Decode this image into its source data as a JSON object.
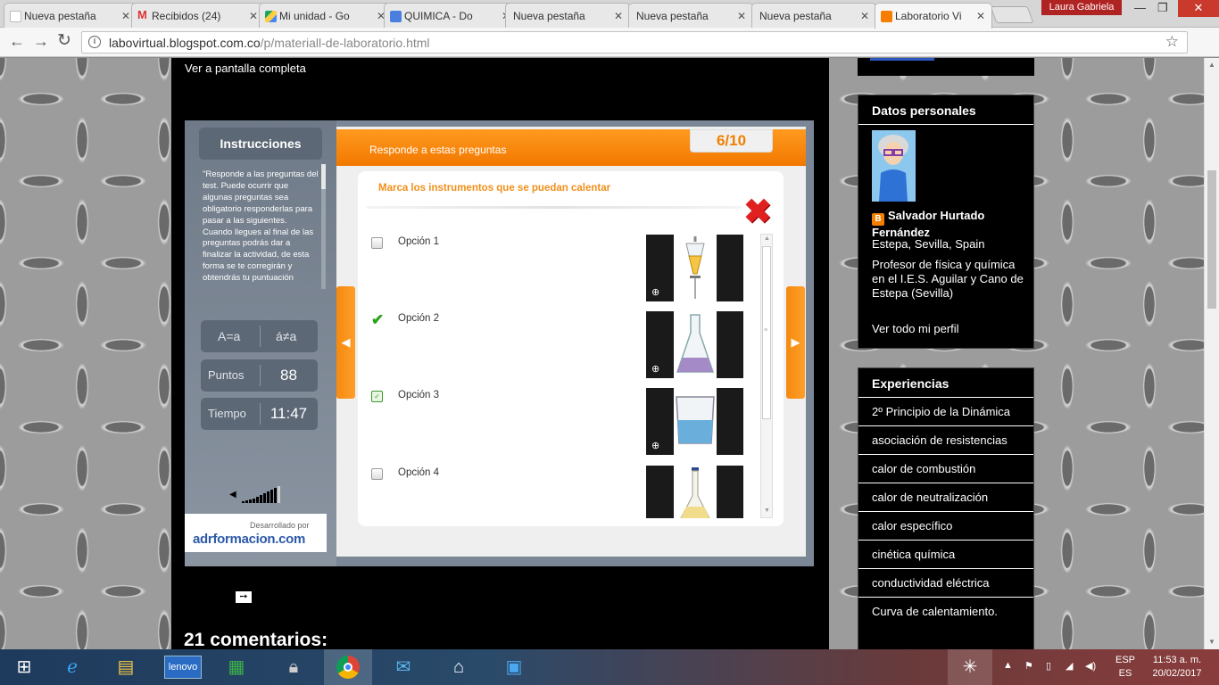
{
  "browser": {
    "tabs": [
      {
        "label": "Nueva pestaña",
        "active": false
      },
      {
        "label": "Recibidos (24)",
        "active": false
      },
      {
        "label": "Mi unidad - Go",
        "active": false
      },
      {
        "label": "QUIMICA - Do",
        "active": false
      },
      {
        "label": "Nueva pestaña",
        "active": false
      },
      {
        "label": "Nueva pestaña",
        "active": false
      },
      {
        "label": "Nueva pestaña",
        "active": false
      },
      {
        "label": "Laboratorio Vi",
        "active": true
      }
    ],
    "profile_name": "Laura Gabriela",
    "url_host": "labovirtual.blogspot.com.co",
    "url_path": "/p/materiall-de-laboratorio.html"
  },
  "page": {
    "fullscreen_link": "Ver a pantalla completa",
    "comments_heading": "21 comentarios:"
  },
  "quiz": {
    "instructions_button": "Instrucciones",
    "instructions_text": "\"Responde a las preguntas del test. Puede ocurrir que algunas preguntas sea obligatorio responderlas para pasar a las siguientes. Cuando llegues al final de las preguntas podrás dar a finalizar la actividad, de esta forma se te corregirán y obtendrás tu puntuación",
    "eq_left": "A=a",
    "eq_right": "á≠a",
    "points_label": "Puntos",
    "points_value": "88",
    "time_label": "Tiempo",
    "time_value": "11:47",
    "developed_by": "Desarrollado por",
    "developer_logo": "adrformacion.com",
    "header_text": "Responde a estas preguntas",
    "counter": "6/10",
    "prompt": "Marca los instrumentos que se puedan calentar",
    "options": [
      {
        "label": "Opción 1",
        "state": "unchecked",
        "instrument": "separatory-funnel"
      },
      {
        "label": "Opción 2",
        "state": "checked",
        "instrument": "erlenmeyer-flask"
      },
      {
        "label": "Opción 3",
        "state": "focused",
        "instrument": "beaker"
      },
      {
        "label": "Opción 4",
        "state": "unchecked",
        "instrument": "volumetric-flask"
      }
    ],
    "prev_arrow": "◀",
    "next_arrow": "▶"
  },
  "sidebar": {
    "profile_heading": "Datos personales",
    "profile_name": "Salvador Hurtado Fernández",
    "profile_location": "Estepa, Sevilla, Spain",
    "profile_description": "Profesor de física y química en el I.E.S. Aguilar y Cano de Estepa (Sevilla)",
    "profile_link": "Ver todo mi perfil",
    "experiences_heading": "Experiencias",
    "experiences": [
      "2º Principio de la Dinámica",
      "asociación de resistencias",
      "calor de combustión",
      "calor de neutralización",
      "calor específico",
      "cinética química",
      "conductividad eléctrica",
      "Curva de calentamiento."
    ]
  },
  "taskbar": {
    "language_top": "ESP",
    "language_bottom": "ES",
    "time": "11:53 a. m.",
    "date": "20/02/2017"
  },
  "colors": {
    "quiz_orange": "#f27800",
    "prompt_orange": "#f0901a",
    "check_green": "#2aa31a",
    "error_red": "#e02020"
  }
}
